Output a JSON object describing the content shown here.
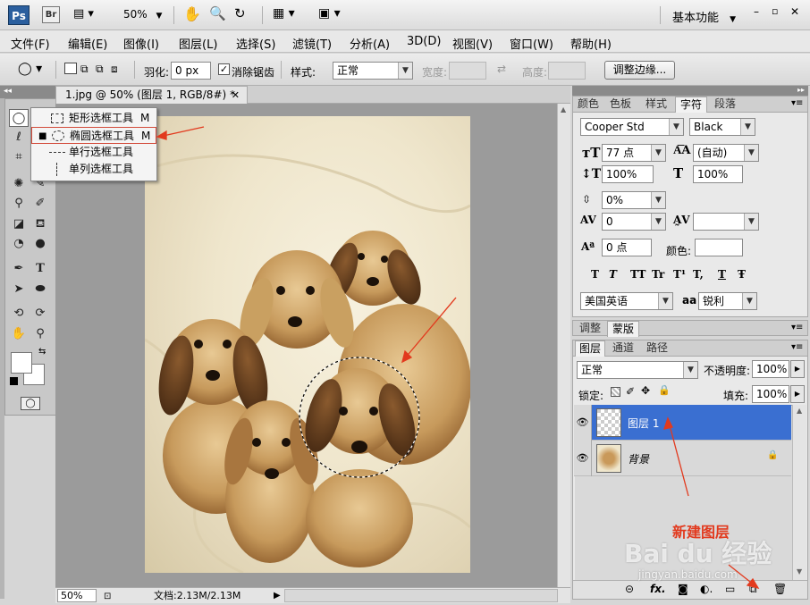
{
  "appbar": {
    "logo": "Ps",
    "bridge": "Br",
    "zoom": "50%",
    "workspace": "基本功能",
    "window_controls": [
      "minimize-icon",
      "restore-icon",
      "close-icon"
    ]
  },
  "menu": [
    "文件(F)",
    "编辑(E)",
    "图像(I)",
    "图层(L)",
    "选择(S)",
    "滤镜(T)",
    "分析(A)",
    "3D(D)",
    "视图(V)",
    "窗口(W)",
    "帮助(H)"
  ],
  "options": {
    "feather_label": "羽化:",
    "feather_value": "0 px",
    "antialias_label": "消除锯齿",
    "antialias_checked": true,
    "style_label": "样式:",
    "style_value": "正常",
    "width_label": "宽度:",
    "height_label": "高度:",
    "refine_edge": "调整边缘..."
  },
  "document": {
    "tab_title": "1.jpg @ 50% (图层 1, RGB/8#) *",
    "zoom": "50%",
    "doc_info": "文档:2.13M/2.13M"
  },
  "flyout": {
    "items": [
      {
        "label": "矩形选框工具",
        "key": "M",
        "selected": false
      },
      {
        "label": "椭圆选框工具",
        "key": "M",
        "selected": true
      },
      {
        "label": "单行选框工具",
        "key": "",
        "selected": false
      },
      {
        "label": "单列选框工具",
        "key": "",
        "selected": false
      }
    ]
  },
  "char_panel": {
    "tabs": [
      "颜色",
      "色板",
      "样式",
      "字符",
      "段落"
    ],
    "active_tab": "字符",
    "font_family": "Cooper Std",
    "font_style": "Black",
    "font_size": "77 点",
    "leading": "(自动)",
    "vscale": "100%",
    "hscale": "100%",
    "baseline_shift_pct": "0%",
    "kerning": "0",
    "tracking": "",
    "baseline": "0 点",
    "color_label": "颜色:",
    "language": "美国英语",
    "aa_icon": "aa",
    "antialias": "锐利",
    "style_buttons": [
      "T",
      "T",
      "TT",
      "Tr",
      "T¹",
      "T,",
      "T",
      "Ŧ"
    ]
  },
  "adj_panel": {
    "tabs": [
      "调整",
      "蒙版"
    ]
  },
  "layers_panel": {
    "tabs": [
      "图层",
      "通道",
      "路径"
    ],
    "blend_mode": "正常",
    "opacity_label": "不透明度:",
    "opacity": "100%",
    "lock_label": "锁定:",
    "fill_label": "填充:",
    "fill": "100%",
    "layers": [
      {
        "name": "图层 1",
        "selected": true,
        "visible": true
      },
      {
        "name": "背景",
        "selected": false,
        "visible": true,
        "locked": true
      }
    ]
  },
  "annotation": {
    "new_layer_text": "新建图层"
  },
  "watermark": {
    "brand": "Bai du 经验",
    "url": "jingyan.baidu.com"
  },
  "colors": {
    "selected_layer": "#3a6fd1",
    "annotation": "#e23a1e"
  }
}
